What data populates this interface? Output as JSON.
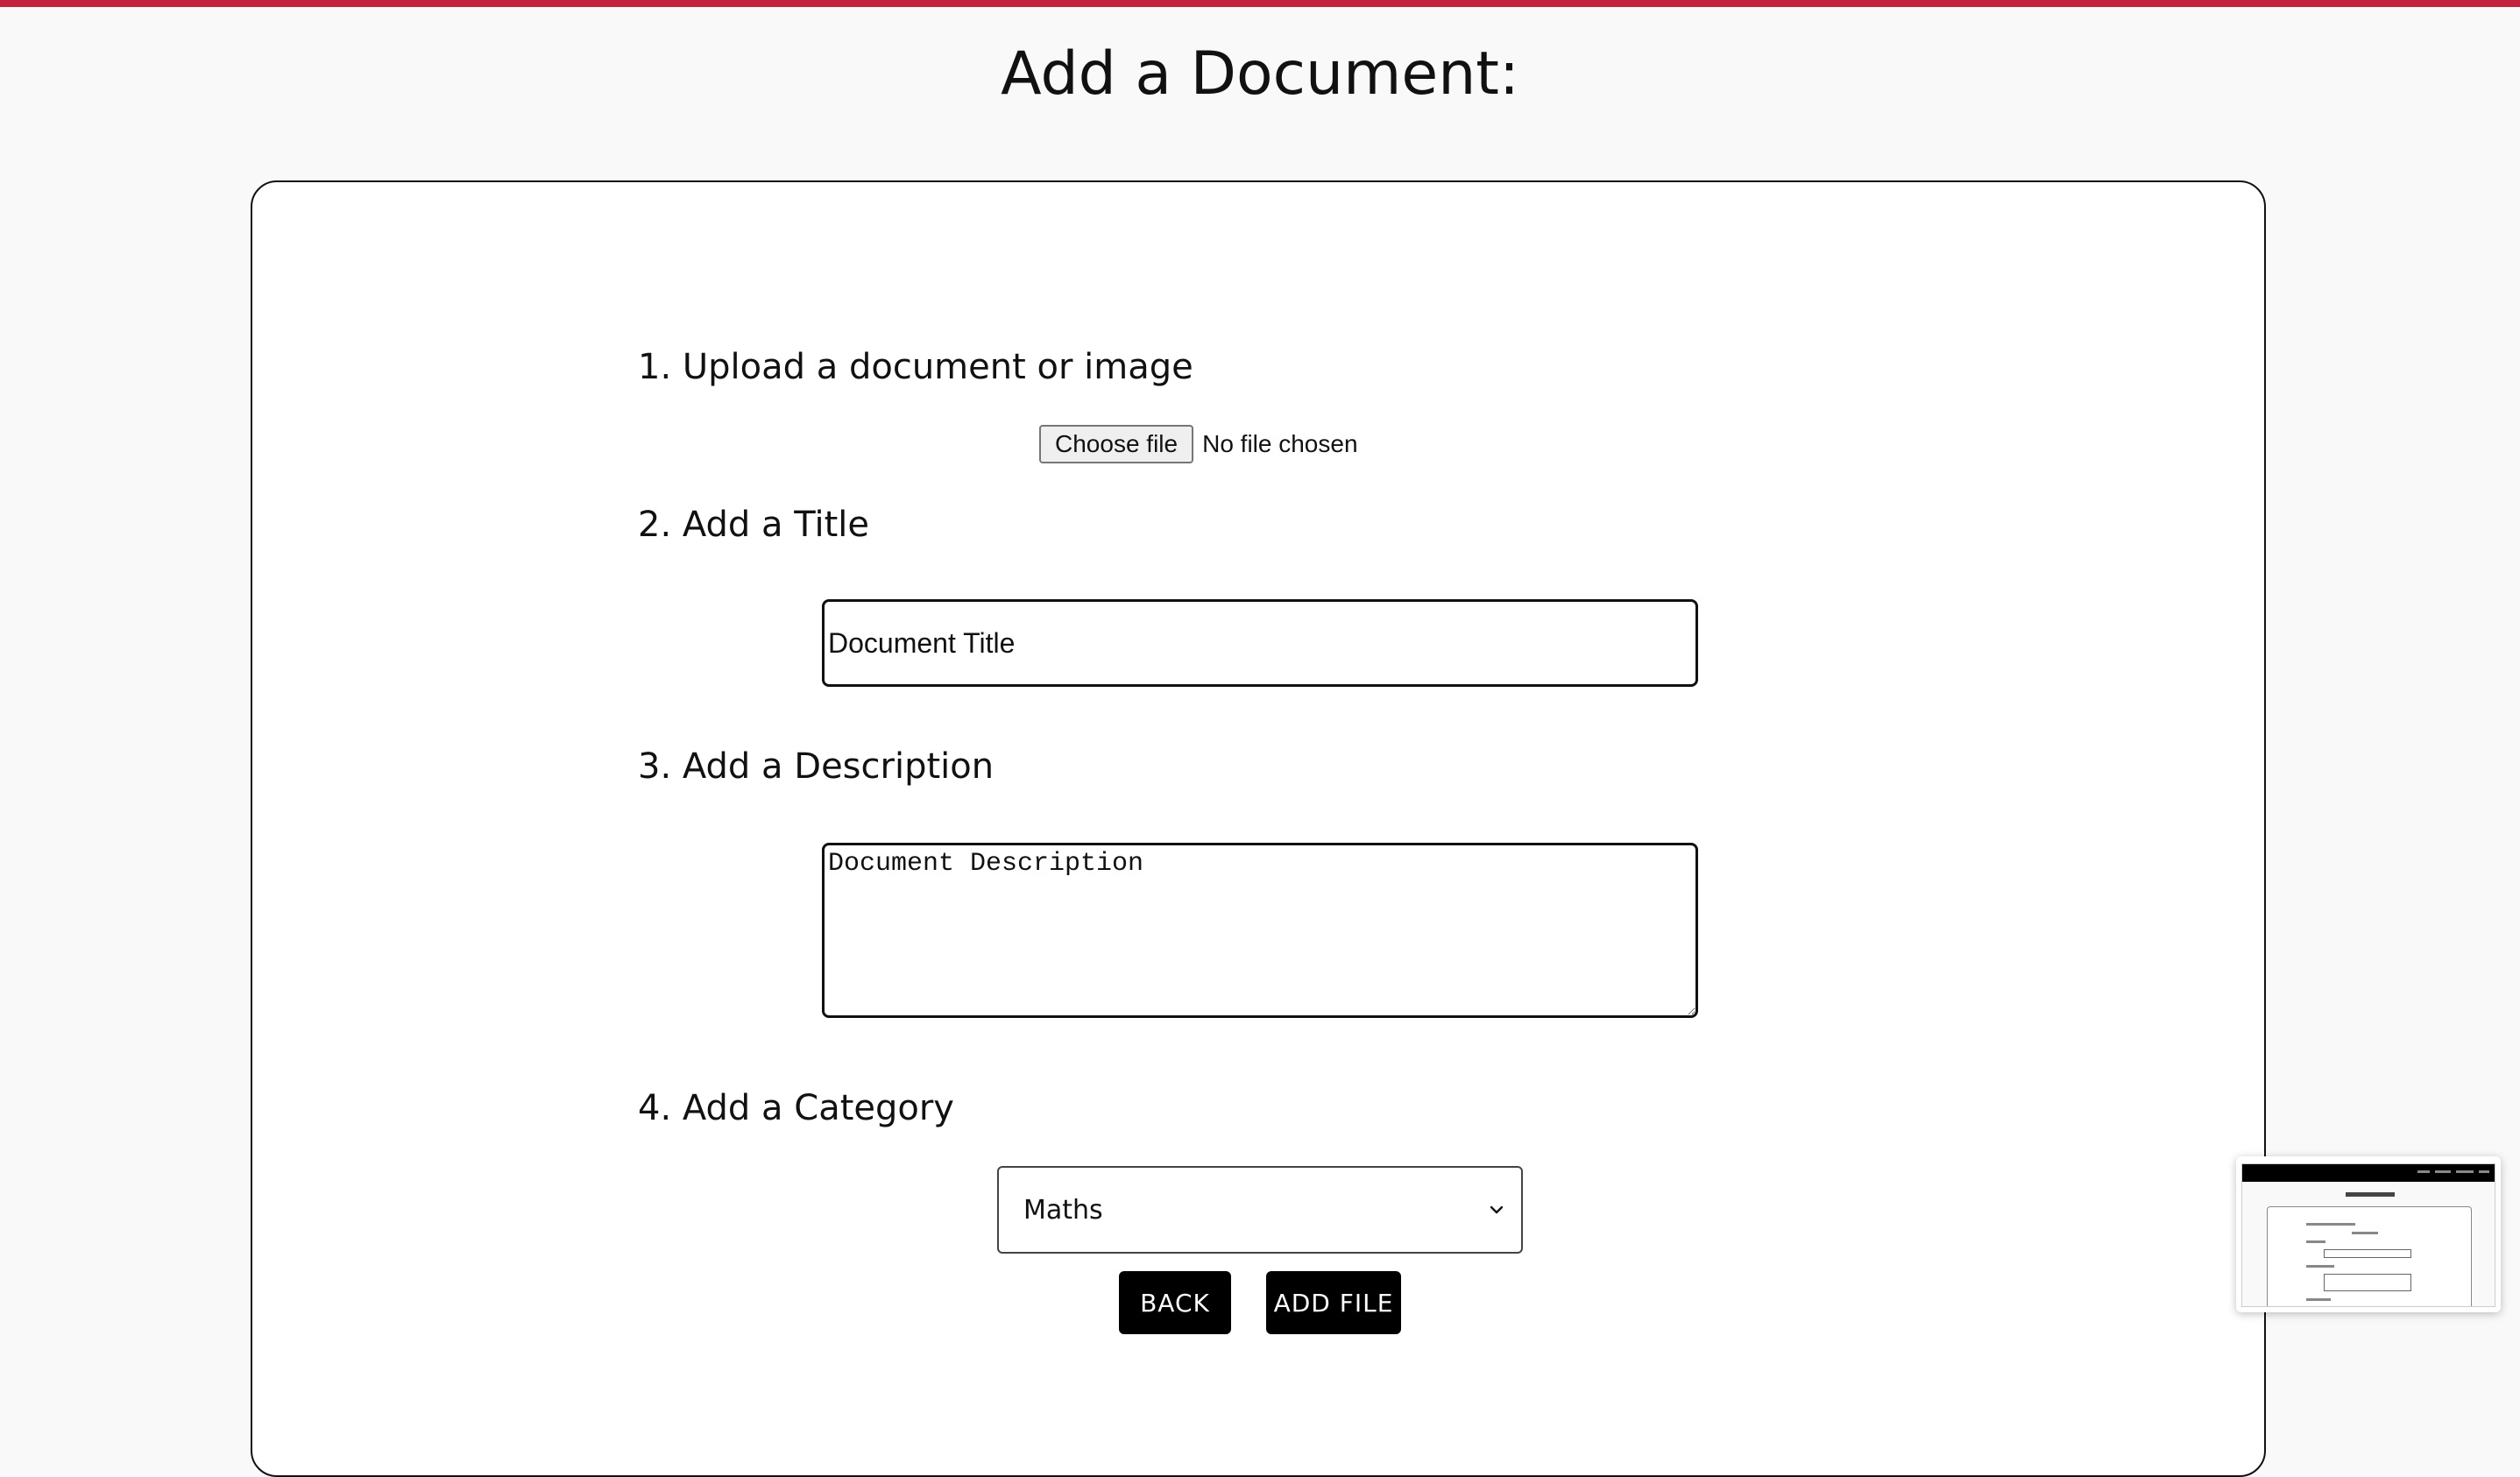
{
  "theme": {
    "accent": "#c3213e",
    "background": "#f9f9f9",
    "button_bg": "#000000",
    "button_text": "#ffffff"
  },
  "page": {
    "title": "Add a Document:"
  },
  "steps": {
    "upload_label": "1. Upload a document or image",
    "title_label": "2. Add a Title",
    "description_label": "3. Add a Description",
    "category_label": "4. Add a Category"
  },
  "file_input": {
    "button_label": "Choose file",
    "status": "No file chosen"
  },
  "title_field": {
    "value": "",
    "placeholder": "Document Title"
  },
  "description_field": {
    "value": "",
    "placeholder": "Document Description"
  },
  "category_select": {
    "selected": "Maths",
    "icon": "chevron-down-icon"
  },
  "actions": {
    "back_label": "BACK",
    "add_file_label": "ADD FILE"
  }
}
